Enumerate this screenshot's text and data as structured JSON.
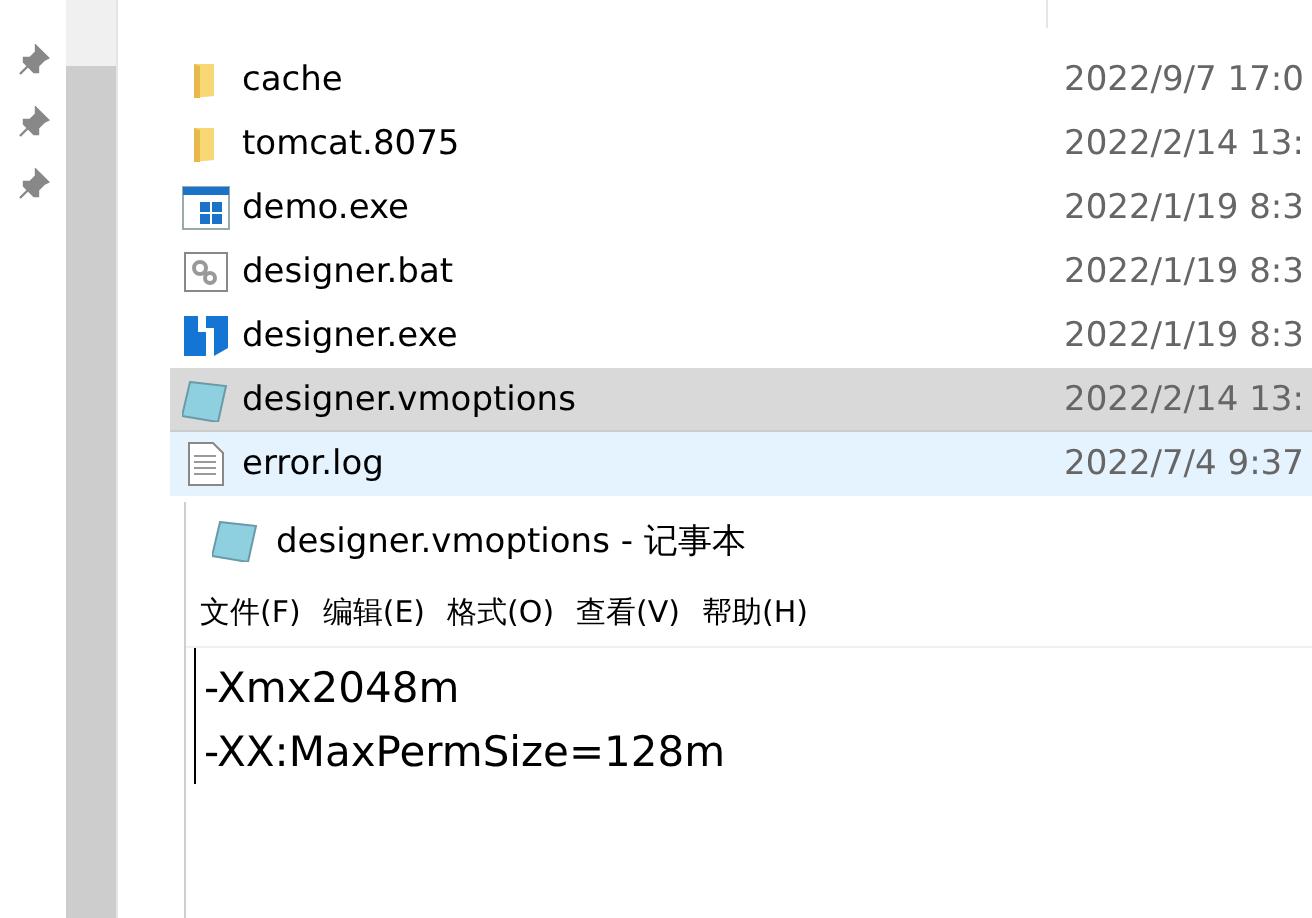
{
  "sidebar": {
    "pins": [
      {
        "kind": "pin"
      },
      {
        "kind": "pin"
      },
      {
        "kind": "pin"
      }
    ]
  },
  "files": [
    {
      "name": "cache",
      "kind": "folder",
      "modified": "2022/9/7 17:0",
      "selected": false,
      "hovered": false
    },
    {
      "name": "tomcat.8075",
      "kind": "folder",
      "modified": "2022/2/14 13:",
      "selected": false,
      "hovered": false
    },
    {
      "name": "demo.exe",
      "kind": "app",
      "modified": "2022/1/19 8:3",
      "selected": false,
      "hovered": false
    },
    {
      "name": "designer.bat",
      "kind": "batch",
      "modified": "2022/1/19 8:3",
      "selected": false,
      "hovered": false
    },
    {
      "name": "designer.exe",
      "kind": "designer",
      "modified": "2022/1/19 8:3",
      "selected": false,
      "hovered": false
    },
    {
      "name": "designer.vmoptions",
      "kind": "notepad",
      "modified": "2022/2/14 13:",
      "selected": true,
      "hovered": false
    },
    {
      "name": "error.log",
      "kind": "text",
      "modified": "2022/7/4 9:37",
      "selected": false,
      "hovered": true
    }
  ],
  "notepad": {
    "title": "designer.vmoptions - 记事本",
    "menu": [
      {
        "label": "文件(F)"
      },
      {
        "label": "编辑(E)"
      },
      {
        "label": "格式(O)"
      },
      {
        "label": "查看(V)"
      },
      {
        "label": "帮助(H)"
      }
    ],
    "lines": [
      "-Xmx2048m",
      "-XX:MaxPermSize=128m"
    ]
  }
}
